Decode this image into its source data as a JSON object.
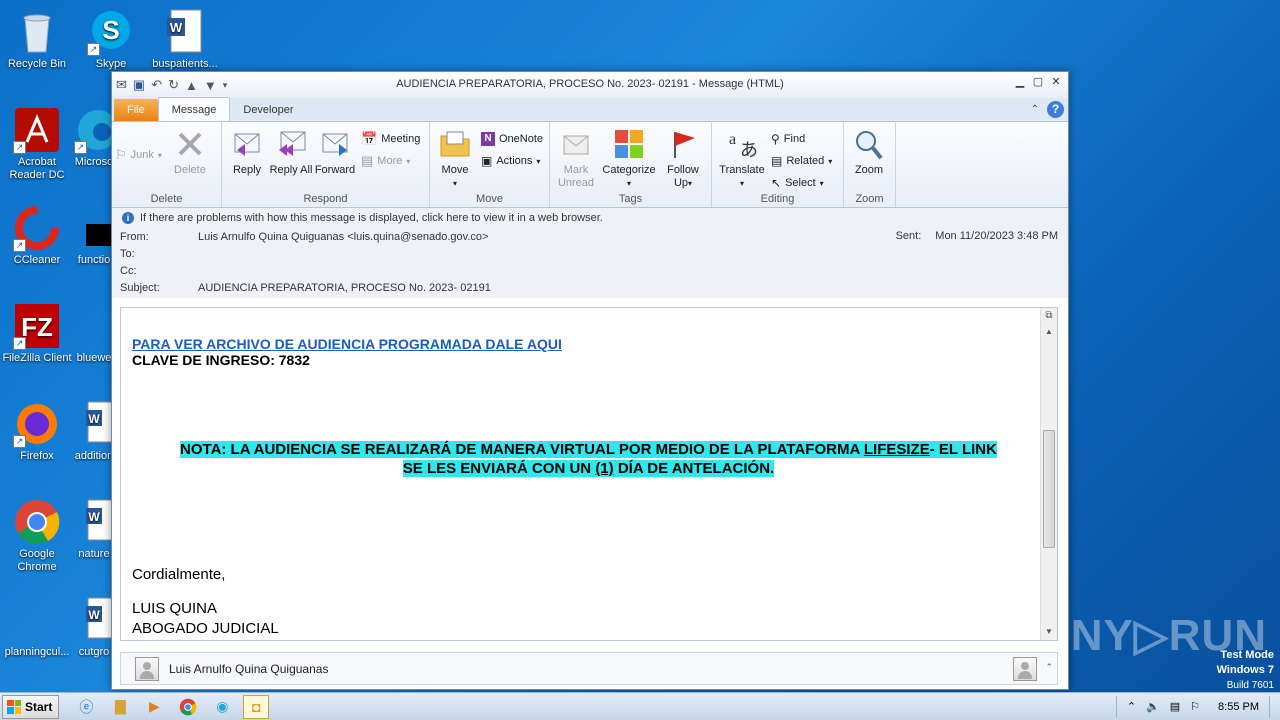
{
  "desktop": {
    "icons": [
      {
        "label": "Recycle Bin"
      },
      {
        "label": "Skype"
      },
      {
        "label": "buspatients..."
      },
      {
        "label": "Acrobat Reader DC"
      },
      {
        "label": "Microso"
      },
      {
        "label": "CCleaner"
      },
      {
        "label": "functio"
      },
      {
        "label": "FileZilla Client"
      },
      {
        "label": "bluewe"
      },
      {
        "label": "Firefox"
      },
      {
        "label": "addition"
      },
      {
        "label": "Google Chrome"
      },
      {
        "label": "nature"
      },
      {
        "label": "planningcul..."
      },
      {
        "label": "cutgro"
      }
    ]
  },
  "window": {
    "title": "AUDIENCIA PREPARATORIA, PROCESO No. 2023- 02191 - Message (HTML)"
  },
  "tabs": {
    "file": "File",
    "message": "Message",
    "developer": "Developer"
  },
  "ribbon": {
    "delete_group": {
      "label": "Delete",
      "junk": "Junk",
      "delete": "Delete"
    },
    "respond_group": {
      "label": "Respond",
      "reply": "Reply",
      "reply_all": "Reply All",
      "forward": "Forward",
      "meeting": "Meeting",
      "more": "More"
    },
    "move_group": {
      "label": "Move",
      "move": "Move",
      "onenote": "OneNote",
      "actions": "Actions"
    },
    "tags_group": {
      "label": "Tags",
      "mark_unread": "Mark Unread",
      "categorize": "Categorize",
      "follow_up": "Follow Up"
    },
    "editing_group": {
      "label": "Editing",
      "translate": "Translate",
      "find": "Find",
      "related": "Related",
      "select": "Select"
    },
    "zoom_group": {
      "label": "Zoom",
      "zoom": "Zoom"
    }
  },
  "header": {
    "info": "If there are problems with how this message is displayed, click here to view it in a web browser.",
    "from_label": "From:",
    "from_value": "Luis Arnulfo Quina Quiguanas <luis.quina@senado.gov.co>",
    "to_label": "To:",
    "cc_label": "Cc:",
    "subject_label": "Subject:",
    "subject_value": "AUDIENCIA PREPARATORIA, PROCESO No. 2023- 02191",
    "sent_label": "Sent:",
    "sent_value": "Mon 11/20/2023 3:48 PM"
  },
  "body": {
    "link": "PARA VER ARCHIVO DE AUDIENCIA PROGRAMADA DALE AQUI",
    "clave": "CLAVE DE INGRESO: 7832",
    "nota_1": "NOTA: LA AUDIENCIA SE REALIZARÁ DE MANERA VIRTUAL POR MEDIO DE LA PLATAFORMA ",
    "nota_lifesize": "LIFESIZE",
    "nota_2": "- EL LINK",
    "nota_3": "SE LES ENVIARÁ CON UN ",
    "nota_one": "(1)",
    "nota_4": " DÍA DE ANTELACIÓN.",
    "closing": "Cordialmente,",
    "sig_name": "LUIS QUINA",
    "sig_title": "ABOGADO JUDICIAL"
  },
  "people_pane": {
    "name": "Luis Arnulfo Quina Quiguanas"
  },
  "watermark": {
    "text": "ANY▷RUN",
    "testmode": "Test Mode",
    "os": "Windows 7",
    "build": "Build 7601"
  },
  "taskbar": {
    "start": "Start",
    "time": "8:55 PM"
  }
}
